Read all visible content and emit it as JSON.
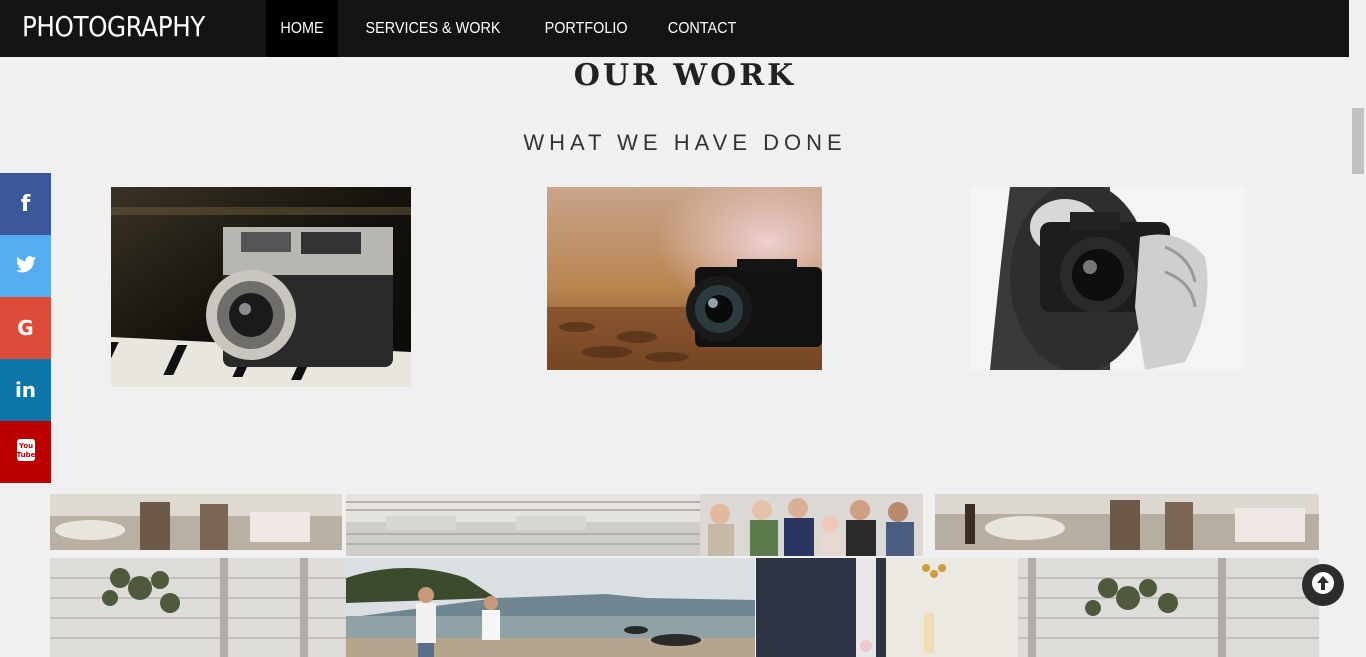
{
  "navbar": {
    "brand": "PHOTOGRAPHY",
    "items": [
      {
        "label": "HOME",
        "active": true
      },
      {
        "label": "SERVICES & WORK",
        "active": false
      },
      {
        "label": "PORTFOLIO",
        "active": false
      },
      {
        "label": "CONTACT",
        "active": false
      }
    ]
  },
  "section": {
    "title": "OUR WORK",
    "subtitle": "WHAT WE HAVE DONE"
  },
  "social": [
    {
      "name": "facebook",
      "icon": "facebook-icon",
      "glyph": "f",
      "color": "#3b5998"
    },
    {
      "name": "twitter",
      "icon": "twitter-icon",
      "glyph": "t",
      "color": "#55acee"
    },
    {
      "name": "google",
      "icon": "google-icon",
      "glyph": "G",
      "color": "#dd4b39"
    },
    {
      "name": "linkedin",
      "icon": "linkedin-icon",
      "glyph": "in",
      "color": "#0e76a8"
    },
    {
      "name": "youtube",
      "icon": "youtube-icon",
      "glyph": "You Tube",
      "color": "#bb0000"
    }
  ],
  "colors": {
    "navbar": "#141414",
    "background": "#f0f0f0",
    "heading": "#222222"
  }
}
